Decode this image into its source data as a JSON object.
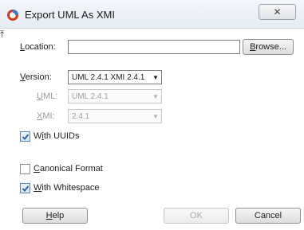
{
  "window": {
    "title": "Export UML As XMI",
    "close_glyph": "✕"
  },
  "corner_mark": "⤒",
  "location": {
    "label_mn": "L",
    "label_rest": "ocation:",
    "value": "",
    "browse_mn": "B",
    "browse_rest": "rowse..."
  },
  "version": {
    "label_mn": "V",
    "label_rest": "ersion:",
    "selected": "UML 2.4.1 XMI 2.4.1"
  },
  "uml": {
    "label_mn": "U",
    "label_rest": "ML:",
    "selected": "UML 2.4.1"
  },
  "xmi": {
    "label_mn": "X",
    "label_rest": "MI:",
    "selected": "2.4.1"
  },
  "options": {
    "uuids": {
      "pre": "W",
      "mn": "i",
      "post": "th UUIDs",
      "checked": true
    },
    "canonical": {
      "pre": "",
      "mn": "C",
      "post": "anonical Format",
      "checked": false
    },
    "whitespace": {
      "pre": "",
      "mn": "W",
      "post": "ith Whitespace",
      "checked": true
    }
  },
  "buttons": {
    "help_mn": "H",
    "help_rest": "elp",
    "ok": "OK",
    "ok_enabled": false,
    "cancel": "Cancel"
  },
  "colors": {
    "check_mark": "#2a5c9a",
    "app_icon_red": "#d9381e",
    "app_icon_blue": "#3a78c2"
  }
}
